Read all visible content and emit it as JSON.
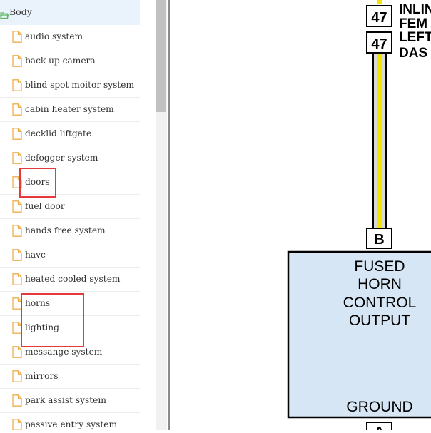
{
  "sidebar": {
    "folder": {
      "label": "Body",
      "icon": "folder-open-icon"
    },
    "items": [
      {
        "label": "audio system"
      },
      {
        "label": "back up camera"
      },
      {
        "label": "blind spot moitor system"
      },
      {
        "label": "cabin heater system"
      },
      {
        "label": "decklid liftgate"
      },
      {
        "label": "defogger system"
      },
      {
        "label": "doors"
      },
      {
        "label": "fuel door"
      },
      {
        "label": "hands free system"
      },
      {
        "label": "havc"
      },
      {
        "label": "heated cooled system"
      },
      {
        "label": "horns"
      },
      {
        "label": "lighting"
      },
      {
        "label": "messange system"
      },
      {
        "label": "mirrors"
      },
      {
        "label": "park assist system"
      },
      {
        "label": "passive entry system"
      }
    ],
    "highlighted": [
      "doors",
      "horns",
      "lighting"
    ]
  },
  "diagram": {
    "connector_top_1": "47",
    "label_top_1": "INLIN",
    "label_top_2": "FEM",
    "connector_top_2": "47",
    "label_top_3": "LEFT",
    "label_top_4": "DAS",
    "pin_b": "B",
    "module_lines": [
      "FUSED",
      "HORN",
      "CONTROL",
      "OUTPUT"
    ],
    "ground_label": "GROUND",
    "pin_a": "A",
    "colors": {
      "module_fill": "#d6e6f5",
      "wire_yellow": "#f2e600",
      "wire_gray": "#d8d8d8",
      "highlight": "#e5393b"
    }
  }
}
